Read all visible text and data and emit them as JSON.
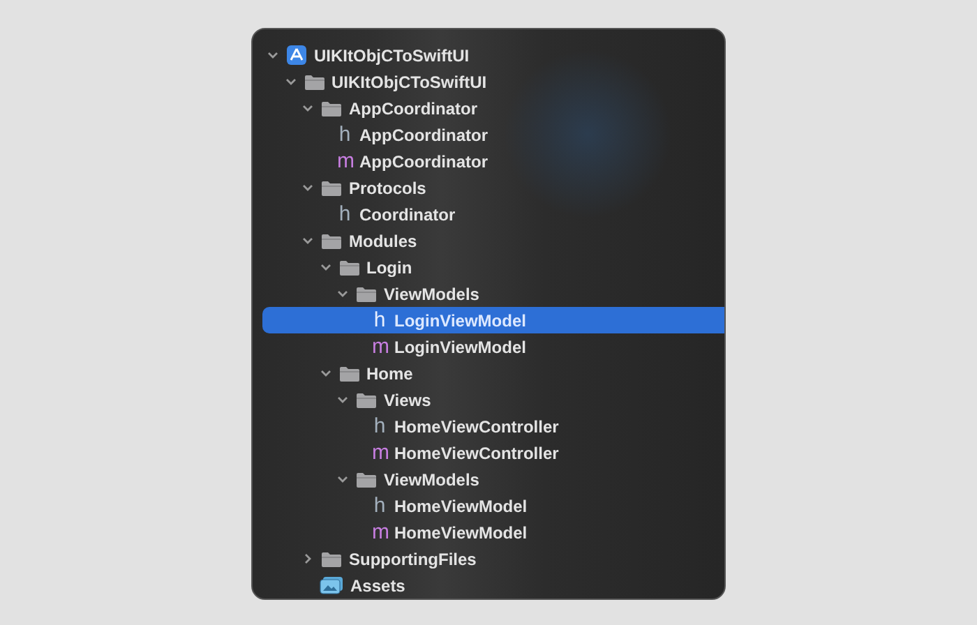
{
  "tree": [
    {
      "label": "UIKItObjCToSwiftUI",
      "kind": "project",
      "expanded": true,
      "selected": false,
      "children": [
        {
          "label": "UIKItObjCToSwiftUI",
          "kind": "folder",
          "expanded": true,
          "selected": false,
          "children": [
            {
              "label": "AppCoordinator",
              "kind": "folder",
              "expanded": true,
              "selected": false,
              "children": [
                {
                  "label": "AppCoordinator",
                  "kind": "header",
                  "badge": "h",
                  "selected": false
                },
                {
                  "label": "AppCoordinator",
                  "kind": "impl",
                  "badge": "m",
                  "selected": false
                }
              ]
            },
            {
              "label": "Protocols",
              "kind": "folder",
              "expanded": true,
              "selected": false,
              "children": [
                {
                  "label": "Coordinator",
                  "kind": "header",
                  "badge": "h",
                  "selected": false
                }
              ]
            },
            {
              "label": "Modules",
              "kind": "folder",
              "expanded": true,
              "selected": false,
              "children": [
                {
                  "label": "Login",
                  "kind": "folder",
                  "expanded": true,
                  "selected": false,
                  "children": [
                    {
                      "label": "ViewModels",
                      "kind": "folder",
                      "expanded": true,
                      "selected": false,
                      "children": [
                        {
                          "label": "LoginViewModel",
                          "kind": "header",
                          "badge": "h",
                          "selected": true
                        },
                        {
                          "label": "LoginViewModel",
                          "kind": "impl",
                          "badge": "m",
                          "selected": false
                        }
                      ]
                    }
                  ]
                },
                {
                  "label": "Home",
                  "kind": "folder",
                  "expanded": true,
                  "selected": false,
                  "children": [
                    {
                      "label": "Views",
                      "kind": "folder",
                      "expanded": true,
                      "selected": false,
                      "children": [
                        {
                          "label": "HomeViewController",
                          "kind": "header",
                          "badge": "h",
                          "selected": false
                        },
                        {
                          "label": "HomeViewController",
                          "kind": "impl",
                          "badge": "m",
                          "selected": false
                        }
                      ]
                    },
                    {
                      "label": "ViewModels",
                      "kind": "folder",
                      "expanded": true,
                      "selected": false,
                      "children": [
                        {
                          "label": "HomeViewModel",
                          "kind": "header",
                          "badge": "h",
                          "selected": false
                        },
                        {
                          "label": "HomeViewModel",
                          "kind": "impl",
                          "badge": "m",
                          "selected": false
                        }
                      ]
                    }
                  ]
                }
              ]
            },
            {
              "label": "SupportingFiles",
              "kind": "folder",
              "expanded": false,
              "selected": false
            },
            {
              "label": "Assets",
              "kind": "assets",
              "selected": false
            }
          ]
        }
      ]
    }
  ]
}
